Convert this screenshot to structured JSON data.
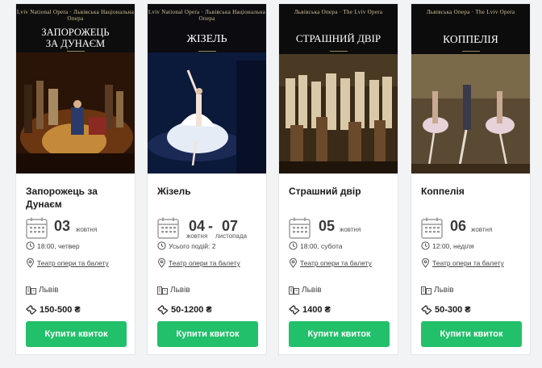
{
  "events": [
    {
      "poster": {
        "brand_left": "Lviv National Opera",
        "brand_right": "Львівська Національна Опера",
        "title_lines": [
          "ЗАПОРОЖЕЦЬ",
          "ЗА ДУНАЄМ"
        ],
        "subtitle": "опера"
      },
      "title": "Запорожець за Дунаєм",
      "day": "03",
      "month": "жовтня",
      "time": "18:00, четвер",
      "venue": "Театр опери та балету",
      "city": "Львів",
      "price": "150-500 ₴",
      "button": "Купити квиток"
    },
    {
      "poster": {
        "brand_left": "Lviv National Opera",
        "brand_right": "Львівська Національна Опера",
        "title_lines": [
          "ЖІЗЕЛЬ"
        ],
        "subtitle": "балет"
      },
      "title": "Жізель",
      "day": "04",
      "month": "жовтня",
      "day_end": "07",
      "month_end": "листопада",
      "time": "Усього подій: 2",
      "venue": "Театр опери та балету",
      "city": "Львів",
      "price": "50-1200 ₴",
      "button": "Купити квиток"
    },
    {
      "poster": {
        "brand_left": "Львівська Опера",
        "brand_right": "The Lviv Opera",
        "title_lines": [
          "СТРАШНИЙ ДВІР"
        ],
        "subtitle": "опера"
      },
      "title": "Страшний двір",
      "day": "05",
      "month": "жовтня",
      "time": "18:00, субота",
      "venue": "Театр опери та балету",
      "city": "Львів",
      "price": "1400 ₴",
      "button": "Купити квиток"
    },
    {
      "poster": {
        "brand_left": "Львівська Опера",
        "brand_right": "The Lviv Opera",
        "title_lines": [
          "КОППЕЛІЯ"
        ],
        "subtitle": "балет"
      },
      "title": "Коппелія",
      "day": "06",
      "month": "жовтня",
      "time": "12:00, неділя",
      "venue": "Театр опери та балету",
      "city": "Львів",
      "price": "50-300 ₴",
      "button": "Купити квиток"
    }
  ],
  "colors": {
    "button": "#22c06a",
    "poster_dark": "#111111",
    "gold": "#d8c79a"
  }
}
